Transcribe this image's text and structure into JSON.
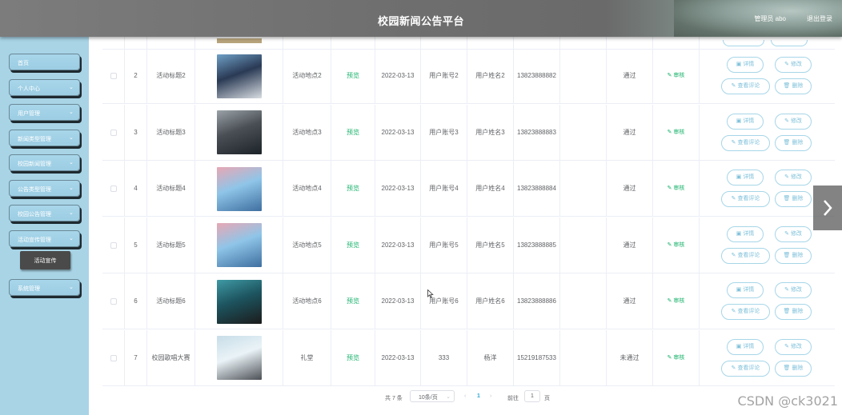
{
  "header": {
    "title": "校园新闻公告平台",
    "user": "管理员 abo",
    "logout": "退出登录"
  },
  "sidebar": {
    "items": [
      {
        "label": "首页",
        "has_chevron": false
      },
      {
        "label": "个人中心",
        "has_chevron": true
      },
      {
        "label": "用户管理",
        "has_chevron": true
      },
      {
        "label": "新闻类型管理",
        "has_chevron": true
      },
      {
        "label": "校园新闻管理",
        "has_chevron": true
      },
      {
        "label": "公告类型管理",
        "has_chevron": true
      },
      {
        "label": "校园公告管理",
        "has_chevron": true
      },
      {
        "label": "活动宣传管理",
        "has_chevron": true
      },
      {
        "label": "系统管理",
        "has_chevron": true
      }
    ],
    "sub_item": "活动宣传",
    "chevron_icon": "chevron-down-icon"
  },
  "table": {
    "rows": [
      {
        "index": "2",
        "title": "活动标题2",
        "location": "活动地点2",
        "preview": "预览",
        "date": "2022-03-13",
        "account": "用户账号2",
        "name": "用户姓名2",
        "phone": "13823888882",
        "status": "通过",
        "review": "审核",
        "img_colors": [
          "#2a3a55",
          "#6fa0c7",
          "#d9dde2"
        ]
      },
      {
        "index": "3",
        "title": "活动标题3",
        "location": "活动地点3",
        "preview": "预览",
        "date": "2022-03-13",
        "account": "用户账号3",
        "name": "用户姓名3",
        "phone": "13823888883",
        "status": "通过",
        "review": "审核",
        "img_colors": [
          "#4a4f55",
          "#9aa3a8",
          "#1c2328"
        ]
      },
      {
        "index": "4",
        "title": "活动标题4",
        "location": "活动地点4",
        "preview": "预览",
        "date": "2022-03-13",
        "account": "用户账号4",
        "name": "用户姓名4",
        "phone": "13823888884",
        "status": "通过",
        "review": "审核",
        "img_colors": [
          "#8fc5e8",
          "#e8a7b4",
          "#3f6fa0"
        ]
      },
      {
        "index": "5",
        "title": "活动标题5",
        "location": "活动地点5",
        "preview": "预览",
        "date": "2022-03-13",
        "account": "用户账号5",
        "name": "用户姓名5",
        "phone": "13823888885",
        "status": "通过",
        "review": "审核",
        "img_colors": [
          "#8fc5e8",
          "#e8a7b4",
          "#3f6fa0"
        ]
      },
      {
        "index": "6",
        "title": "活动标题6",
        "location": "活动地点6",
        "preview": "预览",
        "date": "2022-03-13",
        "account": "用户账号6",
        "name": "用户姓名6",
        "phone": "13823888886",
        "status": "通过",
        "review": "审核",
        "img_colors": [
          "#1d5560",
          "#3f9aa5",
          "#1b1b1b"
        ]
      },
      {
        "index": "7",
        "title": "校园歌唱大赛",
        "location": "礼堂",
        "preview": "预览",
        "date": "2022-03-13",
        "account": "333",
        "name": "杨洋",
        "phone": "15219187533",
        "status": "未通过",
        "review": "审核",
        "img_colors": [
          "#eaf3f7",
          "#c7dde8",
          "#4b4f55"
        ]
      }
    ],
    "buttons": {
      "detail": "详情",
      "edit": "修改",
      "comments": "查看评论",
      "delete": "删除"
    },
    "icons": {
      "detail": "document-icon",
      "edit": "pencil-icon",
      "comments": "pencil-icon",
      "delete": "trash-icon",
      "review": "pencil-icon"
    }
  },
  "pagination": {
    "total": "共 7 条",
    "page_size": "10条/页",
    "current_page": "1",
    "goto_label": "前往",
    "goto_value": "1",
    "page_unit": "页"
  },
  "watermark": "CSDN @ck3021",
  "colors": {
    "sidebar_bg": "#a8d4e6",
    "accent_green": "#19b26b",
    "button_border": "#a7d6e8",
    "sub_item_bg": "#4a4a4a"
  }
}
